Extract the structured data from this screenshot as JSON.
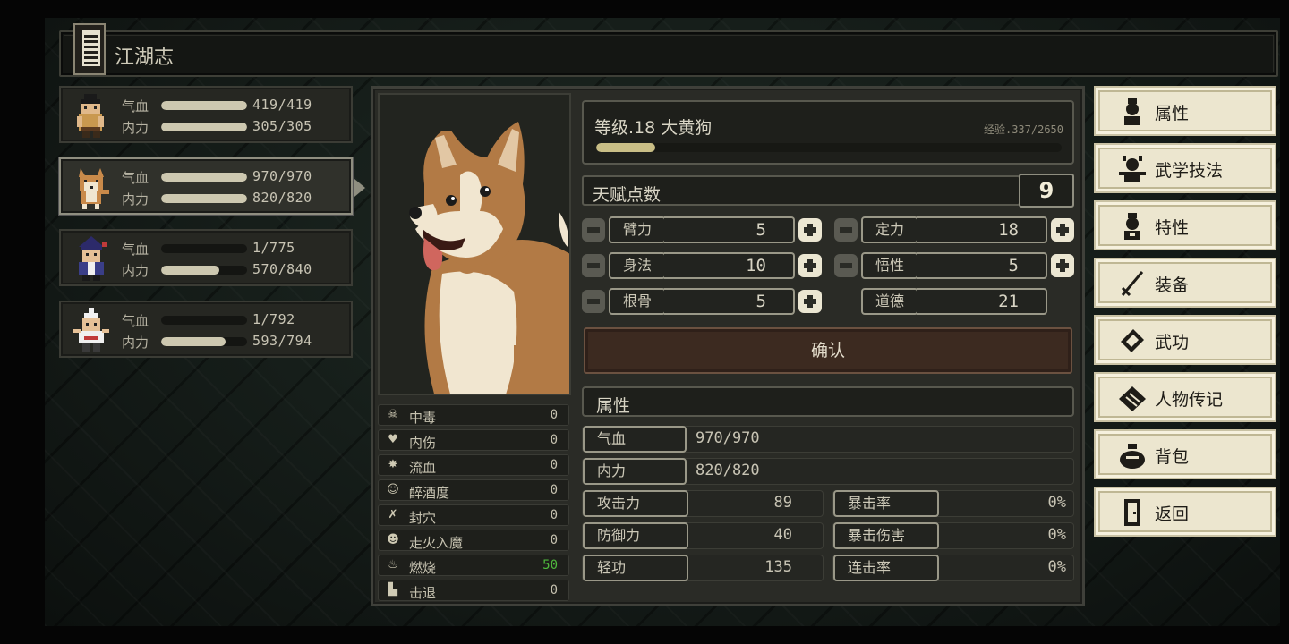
{
  "window": {
    "title": "江湖志"
  },
  "party": [
    {
      "hp_label": "气血",
      "mp_label": "内力",
      "hp": "419/419",
      "mp": "305/305",
      "hp_ratio": 1.0,
      "mp_ratio": 1.0,
      "active": false
    },
    {
      "hp_label": "气血",
      "mp_label": "内力",
      "hp": "970/970",
      "mp": "820/820",
      "hp_ratio": 1.0,
      "mp_ratio": 1.0,
      "active": true
    },
    {
      "hp_label": "气血",
      "mp_label": "内力",
      "hp": "1/775",
      "mp": "570/840",
      "hp_ratio": 0.0,
      "mp_ratio": 0.68,
      "active": false
    },
    {
      "hp_label": "气血",
      "mp_label": "内力",
      "hp": "1/792",
      "mp": "593/794",
      "hp_ratio": 0.0,
      "mp_ratio": 0.75,
      "active": false
    }
  ],
  "status_effects": [
    {
      "icon": "skull-icon",
      "name": "中毒",
      "value": "0"
    },
    {
      "icon": "broken-heart-icon",
      "name": "内伤",
      "value": "0"
    },
    {
      "icon": "blood-splat-icon",
      "name": "流血",
      "value": "0"
    },
    {
      "icon": "drunk-face-icon",
      "name": "醉酒度",
      "value": "0"
    },
    {
      "icon": "acupoint-icon",
      "name": "封穴",
      "value": "0"
    },
    {
      "icon": "demon-mask-icon",
      "name": "走火入魔",
      "value": "0"
    },
    {
      "icon": "flame-icon",
      "name": "燃烧",
      "value": "50",
      "highlight": "#4fb93d"
    },
    {
      "icon": "boot-icon",
      "name": "击退",
      "value": "0"
    }
  ],
  "character": {
    "level_text": "等级.18  大黄狗",
    "exp_text": "经验.337/2650",
    "exp_ratio": 0.127
  },
  "talent": {
    "label": "天赋点数",
    "value": "9"
  },
  "attributes": {
    "strength": {
      "label": "臂力",
      "value": "5"
    },
    "focus": {
      "label": "定力",
      "value": "18"
    },
    "agility": {
      "label": "身法",
      "value": "10"
    },
    "insight": {
      "label": "悟性",
      "value": "5"
    },
    "constitution": {
      "label": "根骨",
      "value": "5"
    },
    "morality": {
      "label": "道德",
      "value": "21"
    }
  },
  "confirm_label": "确认",
  "attr_section": {
    "title": "属性",
    "hp_label": "气血",
    "hp_value": "970/970",
    "mp_label": "内力",
    "mp_value": "820/820",
    "attack_label": "攻击力",
    "attack_value": "89",
    "crit_rate_label": "暴击率",
    "crit_rate_value": "0%",
    "defense_label": "防御力",
    "defense_value": "40",
    "crit_dmg_label": "暴击伤害",
    "crit_dmg_value": "0%",
    "qinggong_label": "轻功",
    "qinggong_value": "135",
    "combo_label": "连击率",
    "combo_value": "0%"
  },
  "menu": [
    {
      "label": "属性",
      "icon": "character-icon"
    },
    {
      "label": "武学技法",
      "icon": "martial-figure-icon"
    },
    {
      "label": "特性",
      "icon": "trait-figure-icon"
    },
    {
      "label": "装备",
      "icon": "sword-icon"
    },
    {
      "label": "武功",
      "icon": "manual-book-icon"
    },
    {
      "label": "人物传记",
      "icon": "scroll-book-icon"
    },
    {
      "label": "背包",
      "icon": "bag-icon"
    },
    {
      "label": "返回",
      "icon": "door-icon"
    }
  ],
  "colors": {
    "highlight_green": "#4fb93d",
    "menu_bg": "#ece6cf",
    "confirm_bg": "#3c2a20",
    "exp_bar": "#c9be86"
  }
}
